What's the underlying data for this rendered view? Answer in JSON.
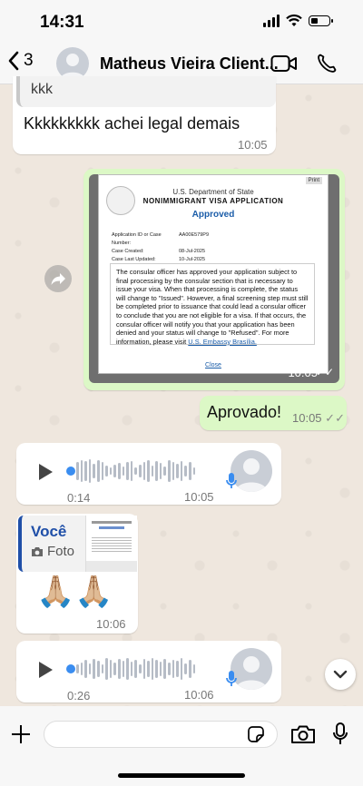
{
  "status": {
    "time": "14:31",
    "battery_level": 0.3
  },
  "header": {
    "back_count": "3",
    "contact_name": "Matheus Vieira Client...",
    "icons": [
      "chevron-left-icon",
      "avatar",
      "video-call-icon",
      "phone-icon"
    ]
  },
  "messages": {
    "m1": {
      "quoted_text": "kkk",
      "text": "Kkkkkkkkk achei legal demais",
      "time": "10:05"
    },
    "image_doc": {
      "print_label": "Print",
      "department": "U.S. Department of State",
      "title": "NONIMMIGRANT VISA APPLICATION",
      "status": "Approved",
      "fields": [
        {
          "label": "Application ID or Case Number:",
          "value": "AA00E579P9"
        },
        {
          "label": "Case Created:",
          "value": "08-Jul-2025"
        },
        {
          "label": "Case Last Updated:",
          "value": "10-Jul-2025"
        }
      ],
      "paragraph": "The consular officer has approved your application subject to final processing by the consular section that is necessary to issue your visa. When that processing is complete, the status will change to \"Issued\". However, a final screening step must still be completed prior to issuance that could lead a consular officer to conclude that you are not eligible for a visa. If that occurs, the consular officer will notify you that your application has been denied and your status will change to \"Refused\". For more information, please visit",
      "link": "U.S. Embassy Brasília.",
      "close": "Close",
      "time": "10:05"
    },
    "m3": {
      "text": "Aprovado!",
      "time": "10:05"
    },
    "voice1": {
      "duration": "0:14",
      "time": "10:05"
    },
    "reply": {
      "author": "Você",
      "media_label": "Foto",
      "emoji": "🙏🏼🙏🏼",
      "time": "10:06"
    },
    "voice2": {
      "duration": "0:26",
      "time": "10:06"
    }
  },
  "colors": {
    "outgoing": "#dcf8c6",
    "incoming": "#ffffff",
    "accent": "#1a73e8",
    "reply_accent": "#1f4fa8"
  }
}
